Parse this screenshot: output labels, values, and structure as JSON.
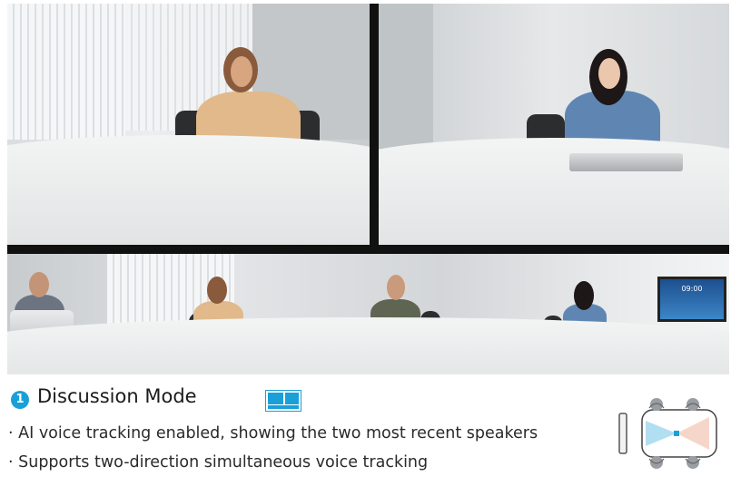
{
  "caption": {
    "badge_number": "1",
    "title": "Discussion Mode",
    "mode_icon": "split-layout-icon",
    "bullets": [
      "· AI voice tracking enabled, showing the two most recent speakers",
      "· Supports two-direction simultaneous voice tracking"
    ]
  },
  "tv_screen": {
    "time": "09:00"
  },
  "colors": {
    "accent": "#1aa0d8",
    "divider": "#111111"
  }
}
